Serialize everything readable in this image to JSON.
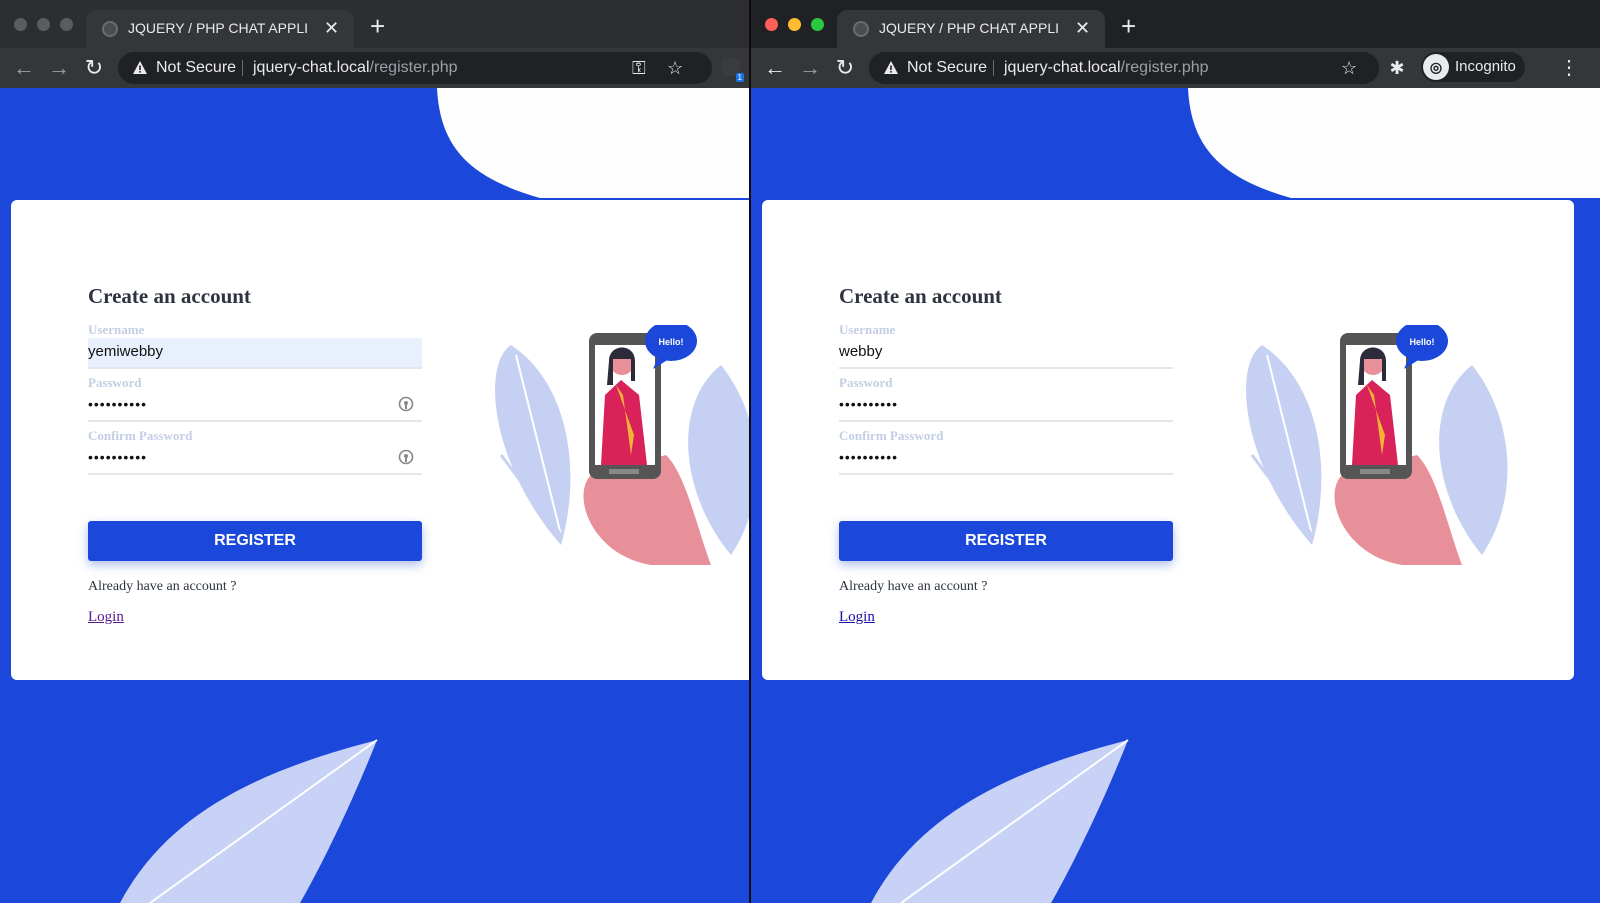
{
  "colors": {
    "brand": "#1b47db",
    "white": "#ffffff",
    "accent_pink": "#e8909a",
    "accent_yellow": "#f2b233"
  },
  "windows": [
    {
      "id": "left",
      "tab_title": "JQUERY / PHP CHAT APPLICAT",
      "security_label": "Not Secure",
      "url_host": "jquery-chat.local",
      "url_path": "/register.php",
      "extension_badge": "1",
      "form": {
        "title": "Create an account",
        "username_label": "Username",
        "username_value": "yemiwebby",
        "password_label": "Password",
        "password_value": "••••••••••",
        "confirm_label": "Confirm Password",
        "confirm_value": "••••••••••",
        "register_label": "REGISTER",
        "hint": "Already have an account ?",
        "login_label": "Login"
      },
      "bubble_text": "Hello!"
    },
    {
      "id": "right",
      "tab_title": "JQUERY / PHP CHAT APPLICAT",
      "security_label": "Not Secure",
      "url_host": "jquery-chat.local",
      "url_path": "/register.php",
      "incognito_label": "Incognito",
      "form": {
        "title": "Create an account",
        "username_label": "Username",
        "username_value": "webby",
        "password_label": "Password",
        "password_value": "••••••••••",
        "confirm_label": "Confirm Password",
        "confirm_value": "••••••••••",
        "register_label": "REGISTER",
        "hint": "Already have an account ?",
        "login_label": "Login"
      },
      "bubble_text": "Hello!"
    }
  ]
}
